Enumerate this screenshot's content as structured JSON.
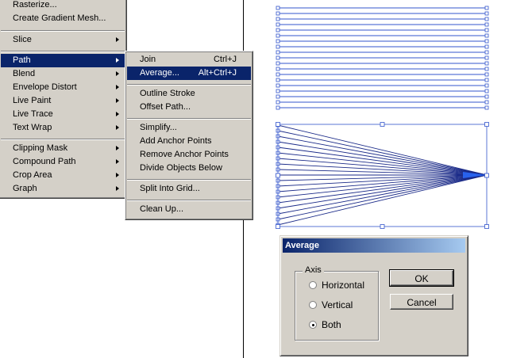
{
  "main_menu": {
    "items": [
      {
        "label": "Rasterize..."
      },
      {
        "label": "Create Gradient Mesh..."
      },
      {
        "label": "Slice"
      },
      {
        "label": "Path"
      },
      {
        "label": "Blend"
      },
      {
        "label": "Envelope Distort"
      },
      {
        "label": "Live Paint"
      },
      {
        "label": "Live Trace"
      },
      {
        "label": "Text Wrap"
      },
      {
        "label": "Clipping Mask"
      },
      {
        "label": "Compound Path"
      },
      {
        "label": "Crop Area"
      },
      {
        "label": "Graph"
      }
    ],
    "selected": "Path"
  },
  "path_submenu": {
    "items": [
      {
        "label": "Join",
        "shortcut": "Ctrl+J"
      },
      {
        "label": "Average...",
        "shortcut": "Alt+Ctrl+J"
      },
      {
        "label": "Outline Stroke"
      },
      {
        "label": "Offset Path..."
      },
      {
        "label": "Simplify..."
      },
      {
        "label": "Add Anchor Points"
      },
      {
        "label": "Remove Anchor Points"
      },
      {
        "label": "Divide Objects Below"
      },
      {
        "label": "Split Into Grid..."
      },
      {
        "label": "Clean Up..."
      }
    ],
    "selected": "Average..."
  },
  "artwork": {
    "stroke_color": "#3355cc",
    "fan_tip_color": "#2b6cff",
    "horizontal_line_count": 19,
    "fan_line_count": 19
  },
  "dialog": {
    "title": "Average",
    "axis_group_label": "Axis",
    "options": [
      {
        "label": "Horizontal",
        "checked": false
      },
      {
        "label": "Vertical",
        "checked": false
      },
      {
        "label": "Both",
        "checked": true
      }
    ],
    "ok_label": "OK",
    "cancel_label": "Cancel"
  },
  "colors": {
    "menu_bg": "#d4d0c8",
    "highlight": "#0a246a",
    "title_gradient_end": "#a6caf0"
  }
}
